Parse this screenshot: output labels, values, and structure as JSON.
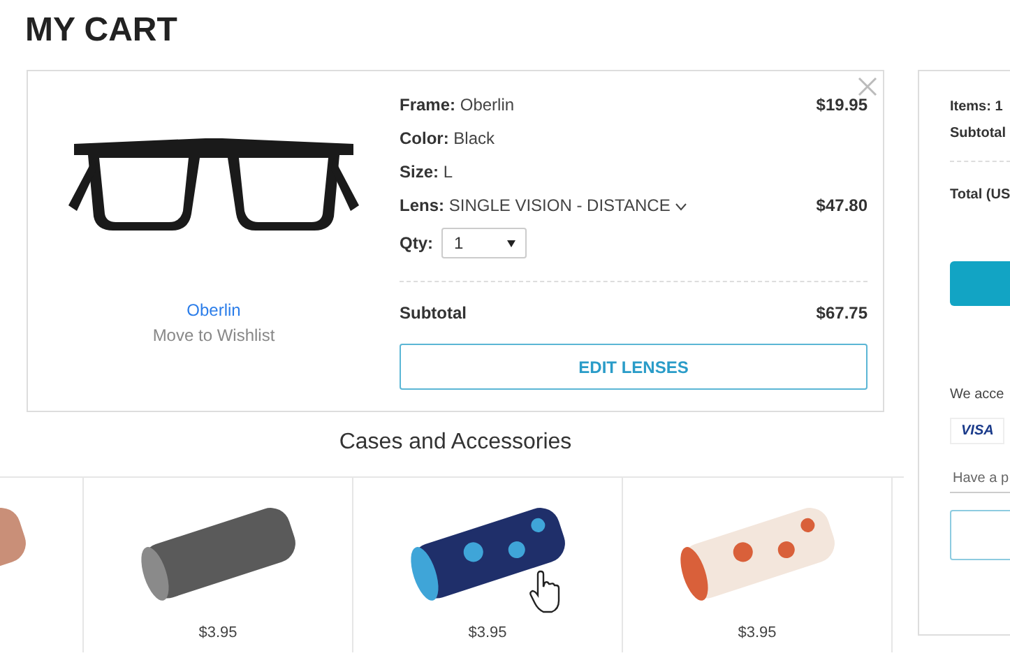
{
  "page": {
    "title": "MY CART"
  },
  "cart_item": {
    "name": "Oberlin",
    "wishlist_link": "Move to Wishlist",
    "details": [
      {
        "label": "Frame:",
        "value": "Oberlin",
        "price": "$19.95",
        "kind": "text"
      },
      {
        "label": "Color:",
        "value": "Black",
        "kind": "text"
      },
      {
        "label": "Size:",
        "value": "L",
        "kind": "text"
      },
      {
        "label": "Lens:",
        "value": "SINGLE VISION - DISTANCE",
        "price": "$47.80",
        "kind": "dropdown"
      }
    ],
    "qty": {
      "label": "Qty:",
      "value": "1"
    },
    "subtotal": {
      "label": "Subtotal",
      "price": "$67.75"
    },
    "button": "EDIT LENSES"
  },
  "accessories": {
    "title": "Cases and Accessories",
    "items": [
      {
        "kind": "tan"
      },
      {
        "kind": "gray",
        "price": "$3.95"
      },
      {
        "kind": "floral",
        "price": "$3.95",
        "hovered": true
      },
      {
        "kind": "birds",
        "price": "$3.95"
      }
    ]
  },
  "summary": {
    "items": "Items: 1",
    "subtotal_label": "Subtotal",
    "total_label": "Total (US",
    "accept_text": "We acce",
    "card": "VISA",
    "promo_placeholder": "Have a p"
  }
}
